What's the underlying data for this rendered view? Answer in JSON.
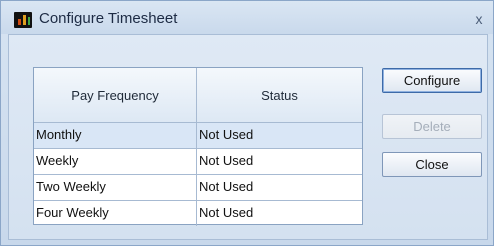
{
  "window": {
    "title": "Configure Timesheet",
    "close_glyph": "x"
  },
  "table": {
    "columns": [
      "Pay Frequency",
      "Status"
    ],
    "rows": [
      {
        "pay_frequency": "Monthly",
        "status": "Not Used"
      },
      {
        "pay_frequency": "Weekly",
        "status": "Not Used"
      },
      {
        "pay_frequency": "Two Weekly",
        "status": "Not Used"
      },
      {
        "pay_frequency": "Four Weekly",
        "status": "Not Used"
      }
    ],
    "selected_row": 0
  },
  "buttons": {
    "configure": "Configure",
    "delete": "Delete",
    "close": "Close"
  },
  "icons": {
    "app": "timesheet-app-icon"
  }
}
